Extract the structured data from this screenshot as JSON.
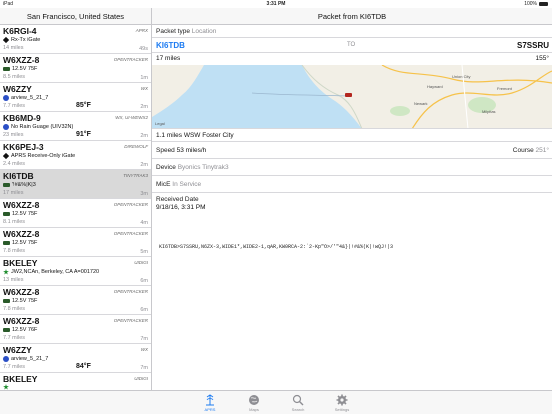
{
  "status_bar": {
    "carrier": "iPad",
    "time": "3:31 PM",
    "battery": "100%"
  },
  "left": {
    "title": "San Francisco, United States",
    "stations": [
      {
        "call": "K6RGI-4",
        "source": "APRX",
        "symbol": "diamond",
        "comment": "Rx-Tx iGate",
        "distance": "14 miles",
        "age": "49s",
        "temp": ""
      },
      {
        "call": "W6XZZ-8",
        "source": "OPENTRACKER",
        "symbol": "car",
        "comment": "12.5V  75F",
        "distance": "8.5 miles",
        "age": "1m",
        "temp": ""
      },
      {
        "call": "W6ZZY",
        "source": "WX",
        "symbol": "circle",
        "comment": "arview_5_21_7",
        "distance": "7.7 miles",
        "age": "2m",
        "temp": "85°F"
      },
      {
        "call": "KB6MD-9",
        "source": "WX, UI-WEWX2",
        "symbol": "circle",
        "comment": "No Rain Guage (UIV32N)",
        "distance": "23 miles",
        "age": "2m",
        "temp": "91°F"
      },
      {
        "call": "KK6PEJ-3",
        "source": "DIREWOLF",
        "symbol": "diamond",
        "comment": "APRS Receive-Only iGate",
        "distance": "2.4 miles",
        "age": "2m",
        "temp": ""
      },
      {
        "call": "KI6TDB",
        "source": "TINYTRAK3",
        "symbol": "car",
        "comment": "'!#&%|K|3",
        "distance": "17 miles",
        "age": "3m",
        "temp": ""
      },
      {
        "call": "W6XZZ-8",
        "source": "OPENTRACKER",
        "symbol": "car",
        "comment": "12.5V  75F",
        "distance": "8.1 miles",
        "age": "4m",
        "temp": ""
      },
      {
        "call": "W6XZZ-8",
        "source": "OPENTRACKER",
        "symbol": "car",
        "comment": "12.5V  75F",
        "distance": "7.8 miles",
        "age": "5m",
        "temp": ""
      },
      {
        "call": "BKELEY",
        "source": "UIDIGI",
        "symbol": "star",
        "comment": "JW2,NCAn, Berkeley, CA A=001720",
        "distance": "13 miles",
        "age": "6m",
        "temp": ""
      },
      {
        "call": "W6XZZ-8",
        "source": "OPENTRACKER",
        "symbol": "car",
        "comment": "12.5V  75F",
        "distance": "7.8 miles",
        "age": "6m",
        "temp": ""
      },
      {
        "call": "W6XZZ-8",
        "source": "OPENTRACKER",
        "symbol": "car",
        "comment": "12.5V  76F",
        "distance": "7.7 miles",
        "age": "7m",
        "temp": ""
      },
      {
        "call": "W6ZZY",
        "source": "WX",
        "symbol": "circle",
        "comment": "arview_5_21_7",
        "distance": "7.7 miles",
        "age": "7m",
        "temp": "84°F"
      },
      {
        "call": "BKELEY",
        "source": "UIDIGI",
        "symbol": "star",
        "comment": "",
        "distance": "",
        "age": "",
        "temp": ""
      }
    ]
  },
  "detail": {
    "title": "Packet from KI6TDB",
    "packet_type_label": "Packet type",
    "packet_type": "Location",
    "from": "KI6TDB",
    "to_label": "TO",
    "to": "S7SSRU",
    "distance": "17 miles",
    "bearing": "155°",
    "map_legal": "Legal",
    "location": "1.1 miles WSW Foster City",
    "speed_label": "Speed",
    "speed": "53 miles/h",
    "course_label": "Course",
    "course": "251°",
    "device_label": "Device",
    "device": "Byonics Tinytrak3",
    "mice_label": "MicE",
    "mice": "In Service",
    "received_label": "Received Date",
    "received": "9/18/16, 3:31 PM",
    "raw": "KI6TDB>S7SSRU,N6ZX-3,WIDE1*,WIDE2-1,qAR,KW0RCA-2:`2-Kp\"O>/'\"4&}|!#&%(K|!wQJ!|3"
  },
  "tabbar": {
    "tabs": [
      {
        "label": "APRS",
        "icon": "aprs-icon",
        "active": true
      },
      {
        "label": "Maps",
        "icon": "globe-icon",
        "active": false
      },
      {
        "label": "Search",
        "icon": "search-icon",
        "active": false
      },
      {
        "label": "Settings",
        "icon": "gear-icon",
        "active": false
      }
    ]
  },
  "colors": {
    "accent": "#1e7cf2",
    "selected_row": "#d9d9d9",
    "water": "#bfe0f4",
    "land": "#f2efe6"
  }
}
